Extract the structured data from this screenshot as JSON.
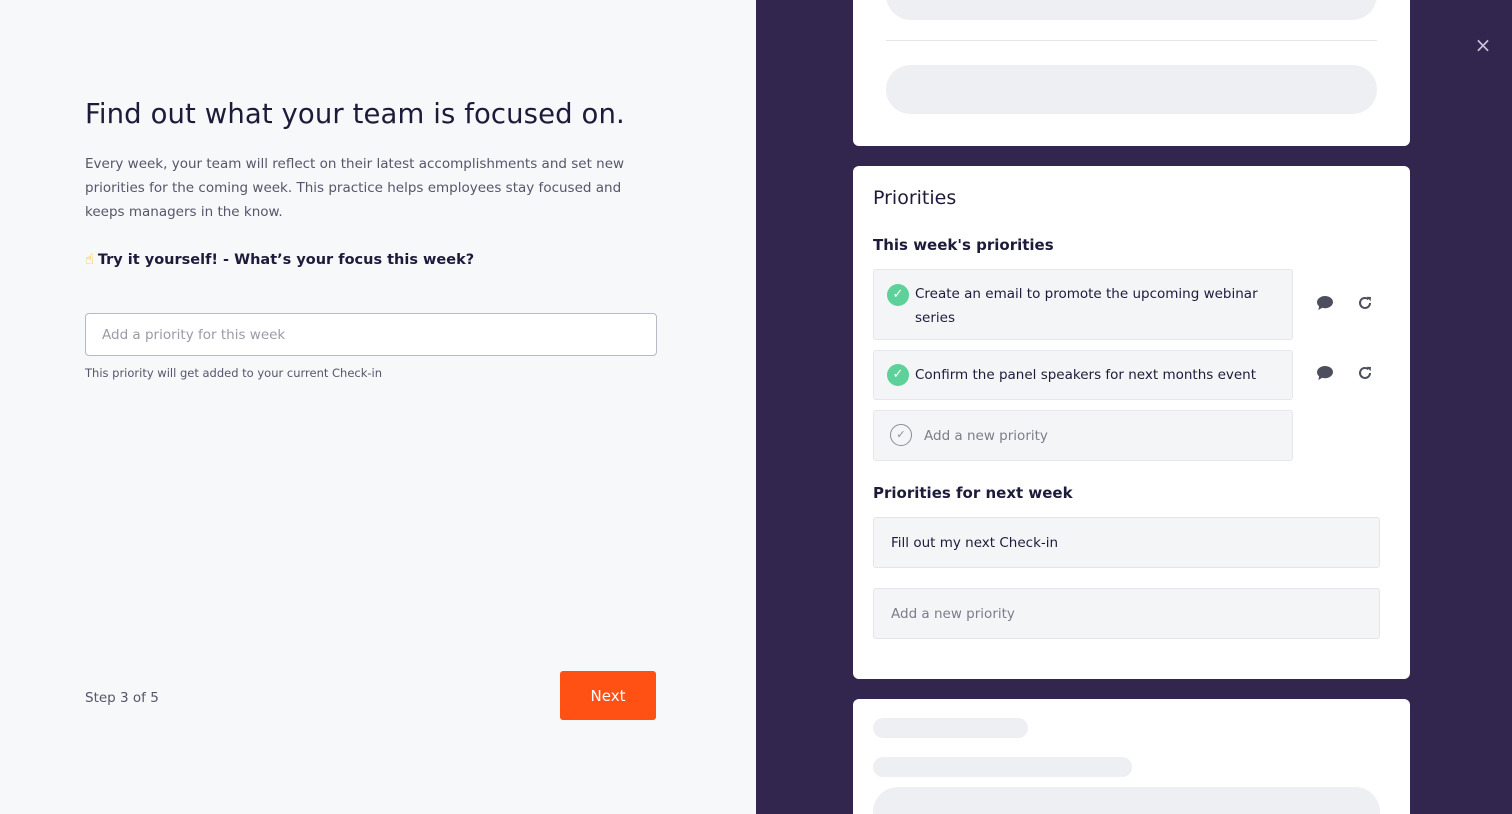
{
  "left": {
    "title": "Find out what your team is focused on.",
    "description": "Every week, your team will reflect on their latest accomplishments and set new priorities for the coming week. This practice helps employees stay focused and keeps managers in the know.",
    "try_emoji": "☝",
    "try_text": "Try it yourself! - What’s your focus this week?",
    "input_placeholder": "Add a priority for this week",
    "input_value": "",
    "helper": "This priority will get added to your current Check-in",
    "step": "Step 3 of 5",
    "next_label": "Next"
  },
  "preview": {
    "close_icon": "×",
    "section_title": "Priorities",
    "this_week_heading": "This week's priorities",
    "this_week_items": [
      {
        "text": "Create an email to promote the upcoming webinar series",
        "done": true
      },
      {
        "text": "Confirm the panel speakers for next months event",
        "done": true
      }
    ],
    "add_priority_placeholder": "Add a new priority",
    "next_week_heading": "Priorities for next week",
    "next_week_items": [
      {
        "text": "Fill out my next Check-in"
      }
    ],
    "next_week_add_placeholder": "Add a new priority"
  },
  "icons": {
    "check": "✓",
    "comment": "comment-icon",
    "redo": "redo-icon",
    "close": "close-icon"
  },
  "colors": {
    "accent": "#ff5114",
    "panel_bg": "#32264f",
    "check_green": "#5dd199",
    "page_bg": "#f7f8fa"
  }
}
